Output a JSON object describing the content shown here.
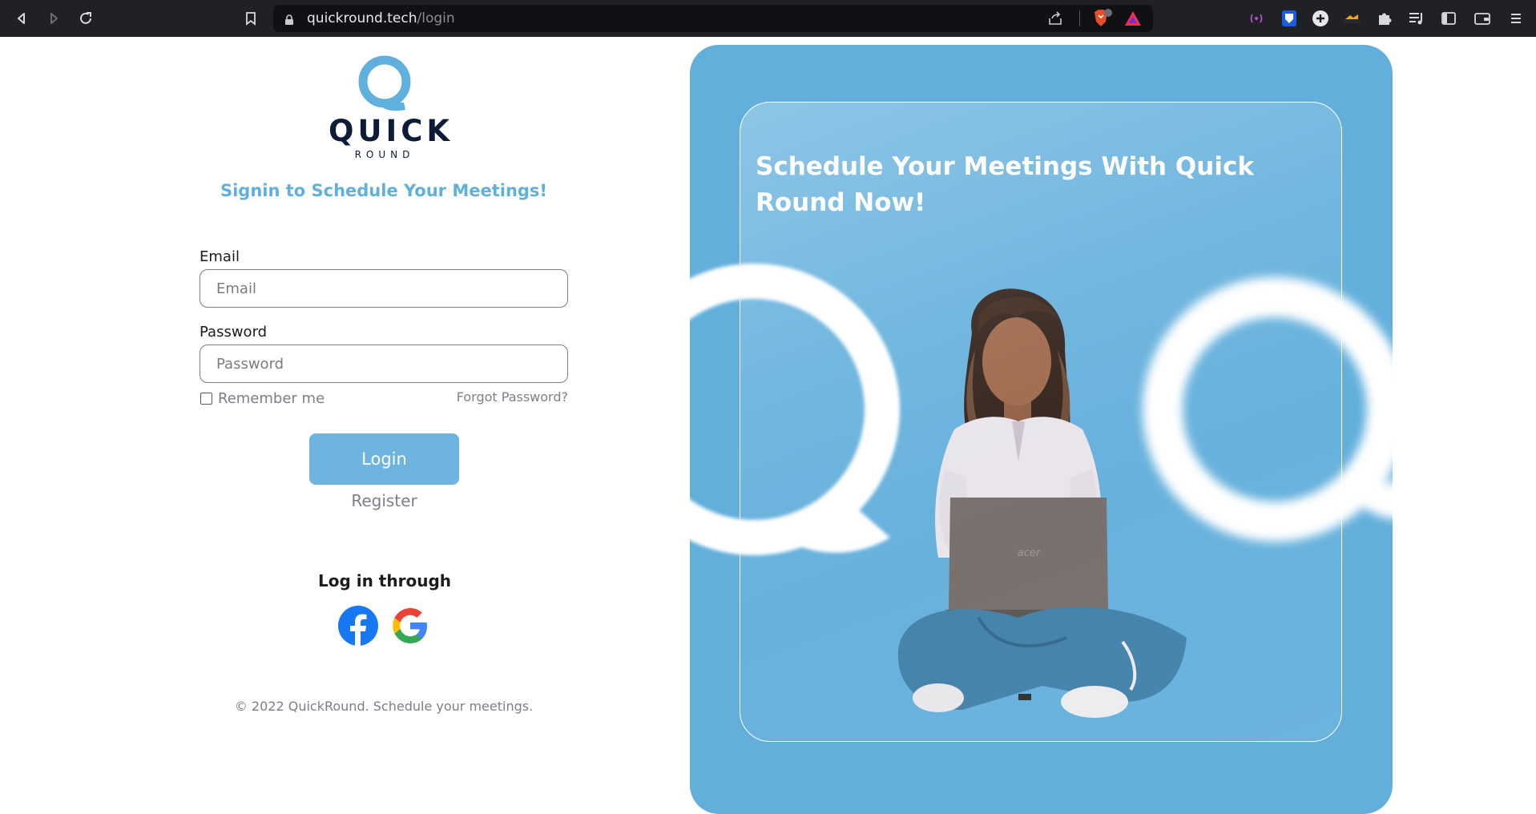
{
  "browser": {
    "url_host": "quickround.tech",
    "url_path": "/login"
  },
  "logo": {
    "word": "QUICK",
    "sub": "ROUND"
  },
  "signin_title": "Signin to Schedule Your Meetings!",
  "form": {
    "email_label": "Email",
    "email_placeholder": "Email",
    "password_label": "Password",
    "password_placeholder": "Password",
    "remember_label": "Remember me",
    "forgot_label": "Forgot Password?",
    "login_label": "Login",
    "register_label": "Register"
  },
  "social": {
    "heading": "Log in through",
    "providers": [
      "facebook-icon",
      "google-icon"
    ]
  },
  "footer": {
    "copyright": "© 2022 QuickRound. Schedule your meetings."
  },
  "hero": {
    "title": "Schedule Your Meetings With Quick Round Now!",
    "laptop_brand": "acer"
  },
  "colors": {
    "accent": "#60b0dd",
    "hero_bg": "#62afdc",
    "button_bg": "#6db5e0",
    "logo_dark": "#0c1b36"
  }
}
